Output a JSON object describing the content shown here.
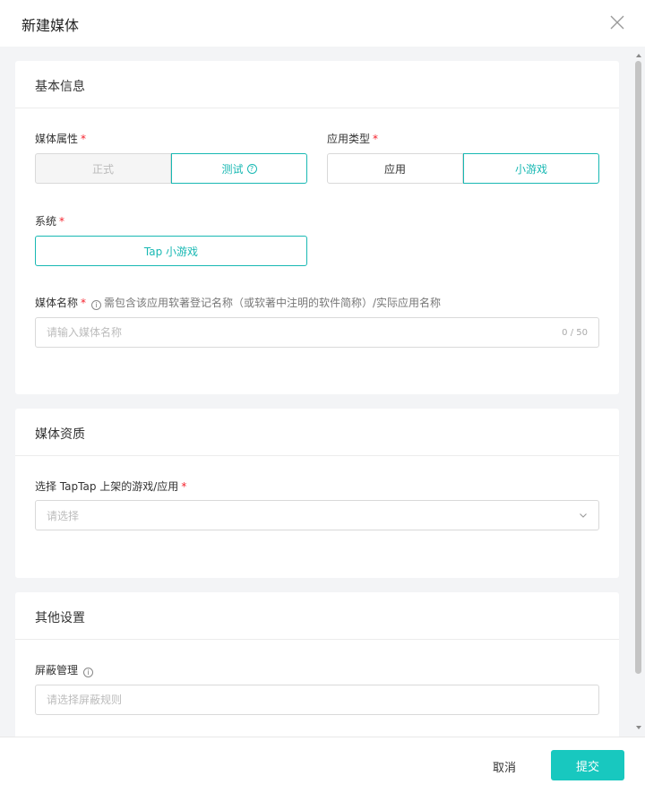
{
  "dialog": {
    "title": "新建媒体",
    "cancel_label": "取消",
    "submit_label": "提交"
  },
  "basic": {
    "heading": "基本信息",
    "attr_label": "媒体属性",
    "attr_options": [
      "正式",
      "测试"
    ],
    "attr_help_icon": "question-circle-icon",
    "app_type_label": "应用类型",
    "app_type_options": [
      "应用",
      "小游戏"
    ],
    "system_label": "系统",
    "system_value": "Tap 小游戏",
    "name_label": "媒体名称",
    "name_hint": "需包含该应用软著登记名称（或软著中注明的软件简称）/实际应用名称",
    "name_placeholder": "请输入媒体名称",
    "name_counter": "0 / 50",
    "required_mark": "*"
  },
  "qualification": {
    "heading": "媒体资质",
    "game_label": "选择 TapTap 上架的游戏/应用",
    "game_placeholder": "请选择"
  },
  "other": {
    "heading": "其他设置",
    "block_label": "屏蔽管理",
    "block_placeholder": "请选择屏蔽规则"
  },
  "colors": {
    "accent": "#18b8b3",
    "submit": "#18c8bf",
    "required": "#f5222d"
  }
}
